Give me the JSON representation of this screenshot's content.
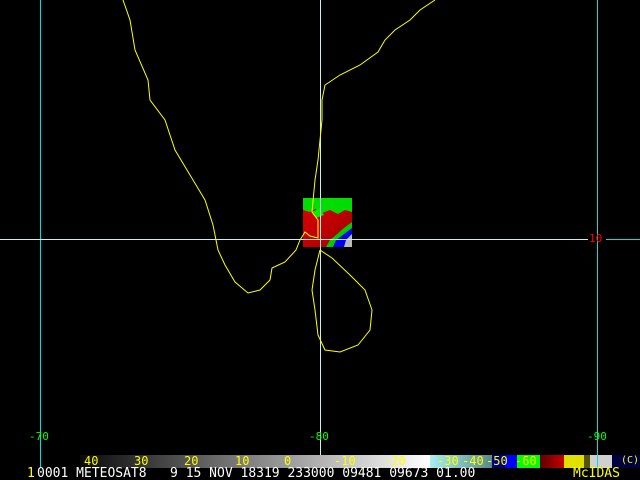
{
  "grid": {
    "lon_labels": [
      "-70",
      "-80",
      "-90"
    ],
    "lat_labels": [
      "10"
    ]
  },
  "colorbar": {
    "labels": [
      "40",
      "30",
      "20",
      "10",
      "0",
      "-10",
      "-20",
      "-30",
      "-40",
      "-50",
      "-60"
    ],
    "copyright": "(C)"
  },
  "status": {
    "frame": "1",
    "info": "0001 METEOSAT8   9 15 NOV 18319 233000 09481 09673 01.00",
    "brand": "McIDAS"
  },
  "colors": {
    "coastline": "#ffff00",
    "grid": "#00e0e0",
    "lon_label": "#00ff00",
    "lat_label": "#ff0000",
    "label_accent": "#ffff00"
  }
}
